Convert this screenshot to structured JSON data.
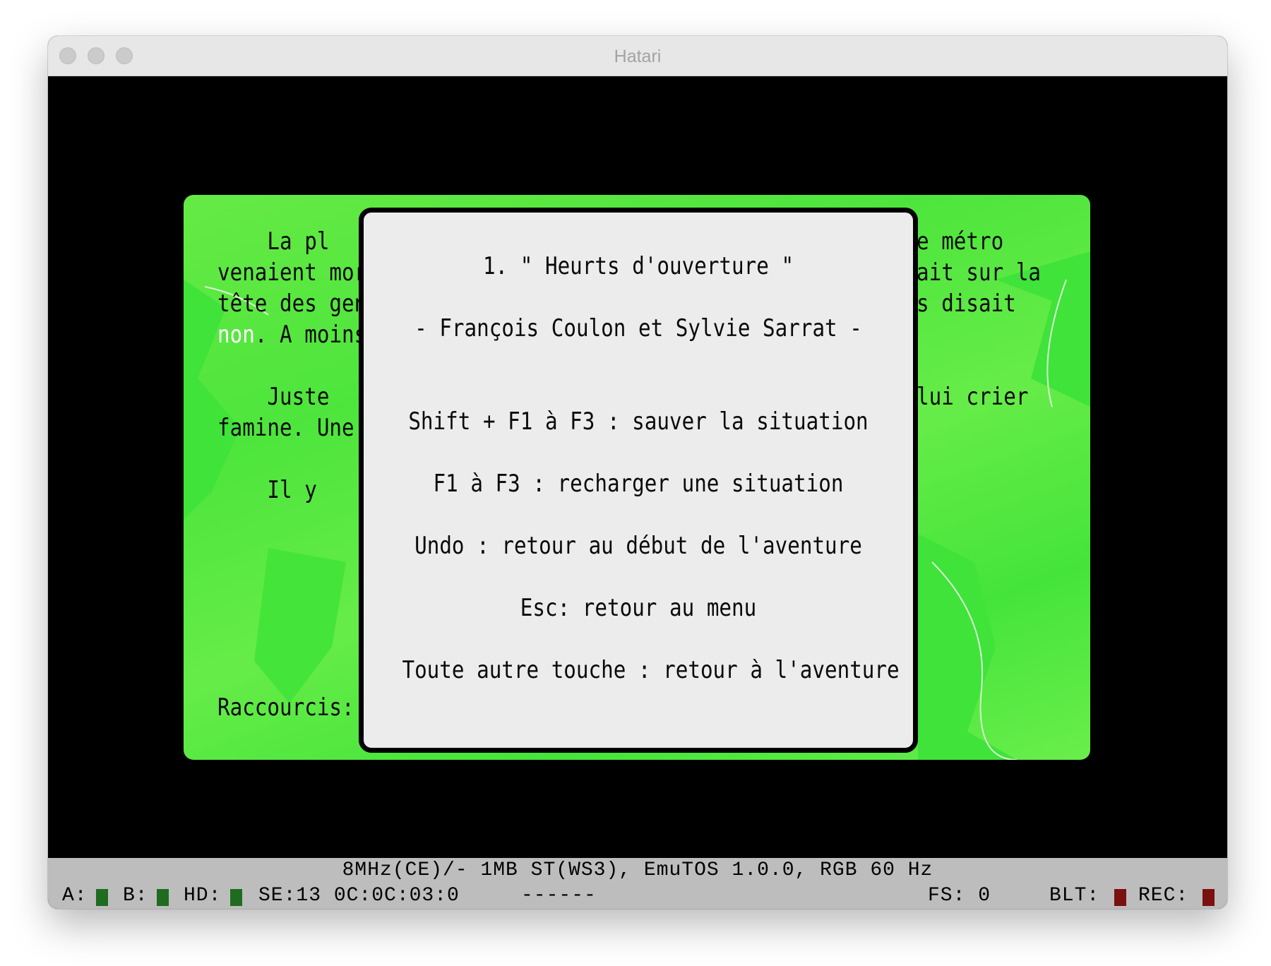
{
  "window": {
    "title": "Hatari"
  },
  "background_text": {
    "left_lines": [
      "    La pl",
      "venaient mor",
      "tête des gen",
      ". A moins",
      "",
      "    Juste",
      "famine. Une",
      "",
      "    Il y",
      "Raccourcis:"
    ],
    "highlight_word": "non",
    "right_lines": [
      "e métro",
      "ait sur la",
      "s disait",
      "lui crier"
    ]
  },
  "dialog": {
    "title": "1. \" Heurts d'ouverture \"",
    "authors": "- François Coulon et Sylvie Sarrat -",
    "shortcuts": [
      "Shift + F1 à F3 : sauver la situation",
      "F1 à F3 : recharger une situation",
      "Undo : retour au début de l'aventure",
      "Esc: retour au menu",
      "Toute autre touche : retour à l'aventure"
    ]
  },
  "statusbar": {
    "line1": "8MHz(CE)/- 1MB ST(WS3), EmuTOS 1.0.0, RGB 60 Hz",
    "drive_a_label": "A:",
    "drive_b_label": "B:",
    "hd_label": "HD:",
    "position": "SE:13 0C:0C:03:0",
    "dashes": "------",
    "fs": "FS: 0",
    "blt_label": "BLT:",
    "rec_label": "REC:",
    "led_green": "#1f6b1f",
    "led_red": "#7a1010"
  }
}
